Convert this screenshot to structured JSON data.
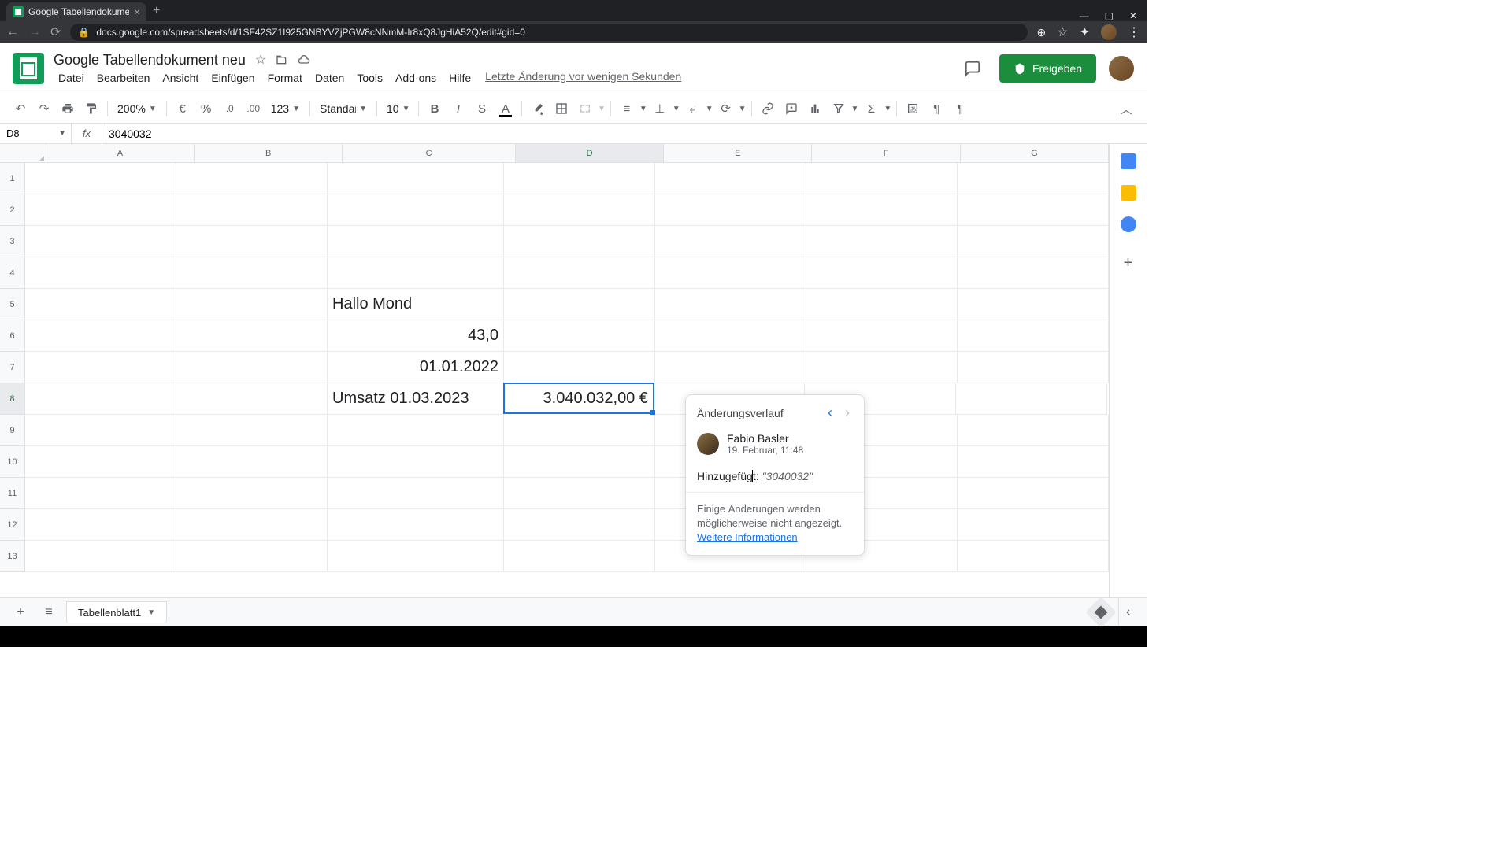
{
  "browser": {
    "tab_title": "Google Tabellendokument neu -",
    "url": "docs.google.com/spreadsheets/d/1SF42SZ1I925GNBYVZjPGW8cNNmM-Ir8xQ8JgHiA52Q/edit#gid=0"
  },
  "doc": {
    "title": "Google Tabellendokument neu",
    "last_edit": "Letzte Änderung vor wenigen Sekunden",
    "share_label": "Freigeben"
  },
  "menu": {
    "file": "Datei",
    "edit": "Bearbeiten",
    "view": "Ansicht",
    "insert": "Einfügen",
    "format": "Format",
    "data": "Daten",
    "tools": "Tools",
    "addons": "Add-ons",
    "help": "Hilfe"
  },
  "toolbar": {
    "zoom": "200%",
    "format_type": "Standard (...",
    "font": "",
    "font_size": "10",
    "number_format": "123"
  },
  "formula": {
    "cell_ref": "D8",
    "value": "3040032"
  },
  "columns": [
    "A",
    "B",
    "C",
    "D",
    "E",
    "F",
    "G"
  ],
  "rows": [
    "1",
    "2",
    "3",
    "4",
    "5",
    "6",
    "7",
    "8",
    "9",
    "10",
    "11",
    "12",
    "13"
  ],
  "cells": {
    "C5": "Hallo Mond",
    "C6": "43,0",
    "C7": "01.01.2022",
    "C8": "Umsatz 01.03.2023",
    "D8": "3.040.032,00 €"
  },
  "history": {
    "title": "Änderungsverlauf",
    "user_name": "Fabio Basler",
    "timestamp": "19. Februar, 11:48",
    "change_label": "Hinzugefügt:",
    "change_value": "\"3040032\"",
    "footer_text": "Einige Änderungen werden möglicherweise nicht angezeigt.",
    "more_info": "Weitere Informationen"
  },
  "sheet_tab": {
    "name": "Tabellenblatt1"
  }
}
